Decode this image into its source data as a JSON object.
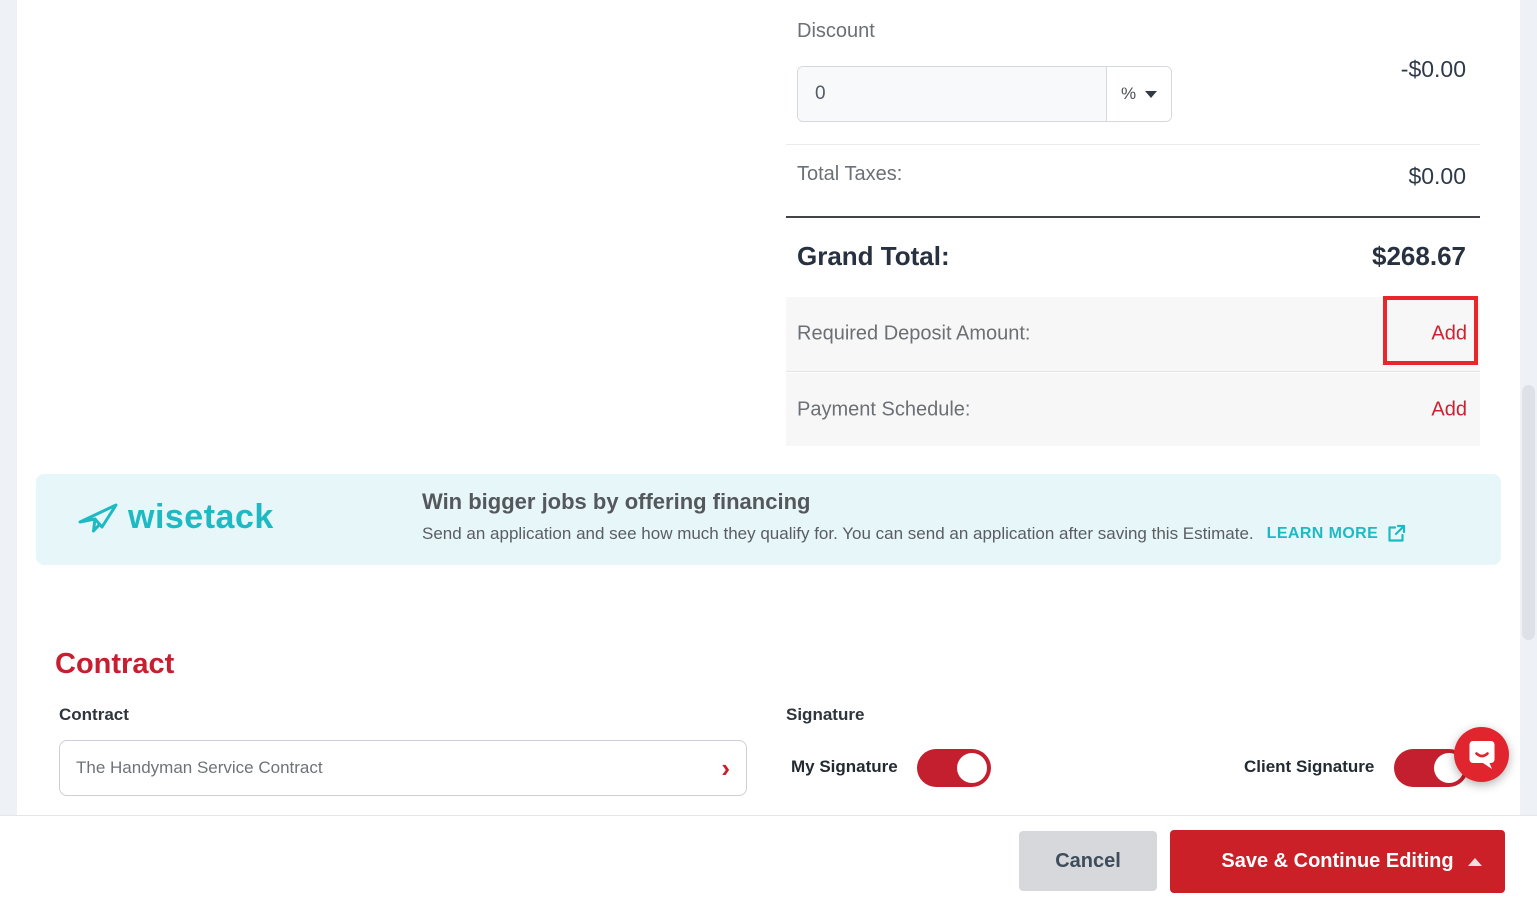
{
  "totals": {
    "discount": {
      "label": "Discount",
      "value": "0",
      "unit": "%",
      "amount": "-$0.00"
    },
    "total_taxes": {
      "label": "Total Taxes:",
      "value": "$0.00"
    },
    "grand_total": {
      "label": "Grand Total:",
      "value": "$268.67"
    },
    "required_deposit": {
      "label": "Required Deposit Amount:",
      "action_label": "Add"
    },
    "payment_schedule": {
      "label": "Payment Schedule:",
      "action_label": "Add"
    }
  },
  "financing_banner": {
    "brand": "wisetack",
    "title": "Win bigger jobs by offering financing",
    "description": "Send an application and see how much they qualify for. You can send an application after saving this Estimate.",
    "link_label": "LEARN MORE"
  },
  "contract": {
    "heading": "Contract",
    "field_label": "Contract",
    "selected_value": "The Handyman Service Contract",
    "chevron": "›"
  },
  "signature": {
    "heading": "Signature",
    "my_signature": {
      "label": "My Signature",
      "enabled": true
    },
    "client_signature": {
      "label": "Client Signature",
      "enabled": true
    }
  },
  "footer": {
    "cancel_label": "Cancel",
    "save_label": "Save & Continue Editing"
  },
  "colors": {
    "accent_red": "#c8202c",
    "save_button_red": "#cb2027",
    "annotation_red": "#e8262b",
    "brand_teal": "#1ebac4",
    "banner_bg": "#e7f6f8",
    "row_bg": "#f7f7f8",
    "page_gutter": "#eef1f5",
    "dark_text": "#28313f",
    "muted_text": "#6b7075"
  }
}
